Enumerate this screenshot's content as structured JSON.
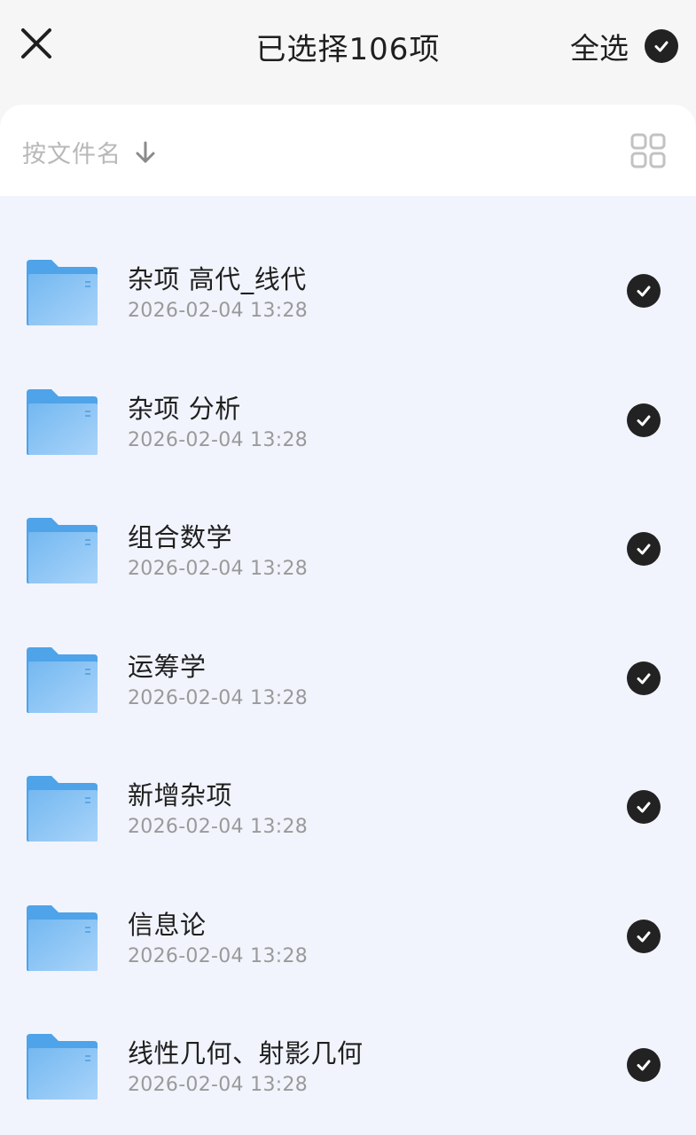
{
  "header": {
    "title": "已选择106项",
    "select_all_label": "全选"
  },
  "sortbar": {
    "sort_label": "按文件名"
  },
  "icons": {
    "close": "close-icon",
    "check": "check-circle-icon",
    "sort": "arrow-down-icon",
    "view": "grid-view-icon",
    "folder": "folder-icon"
  },
  "colors": {
    "background": "#f6f6f6",
    "list_background": "#f1f4fc",
    "check_fill": "#222222",
    "folder_blue": "#6cb6f2",
    "date_text": "#9a9a9a"
  },
  "files": [
    {
      "name": "杂项 高代_线代",
      "date": "2026-02-04  13:28",
      "selected": true
    },
    {
      "name": "杂项 分析",
      "date": "2026-02-04  13:28",
      "selected": true
    },
    {
      "name": "组合数学",
      "date": "2026-02-04  13:28",
      "selected": true
    },
    {
      "name": "运筹学",
      "date": "2026-02-04  13:28",
      "selected": true
    },
    {
      "name": "新增杂项",
      "date": "2026-02-04  13:28",
      "selected": true
    },
    {
      "name": "信息论",
      "date": "2026-02-04  13:28",
      "selected": true
    },
    {
      "name": "线性几何、射影几何",
      "date": "2026-02-04  13:28",
      "selected": true
    }
  ]
}
